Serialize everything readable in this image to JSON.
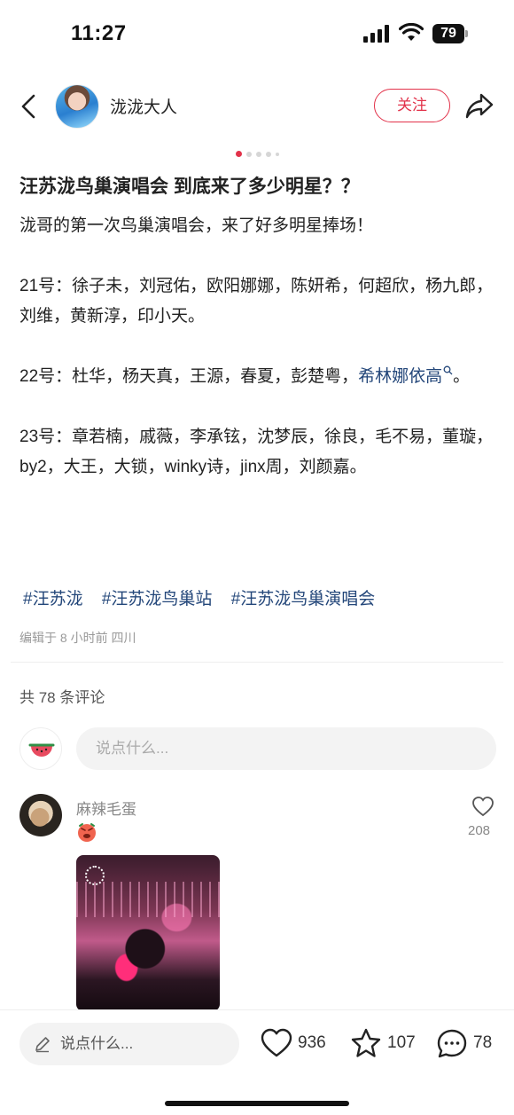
{
  "status_bar": {
    "time": "11:27",
    "battery": "79"
  },
  "header": {
    "author_name": "泷泷大人",
    "follow_label": "关注"
  },
  "carousel": {
    "total": 5,
    "active": 1
  },
  "post": {
    "title": "汪苏泷鸟巢演唱会 到底来了多少明星？？",
    "intro": "泷哥的第一次鸟巢演唱会，来了好多明星捧场！",
    "day21": "21号：徐子未，刘冠佑，欧阳娜娜，陈妍希，何超欣，杨九郎，刘维，黄新淳，印小天。",
    "day22_prefix": "22号：杜华，杨天真，王源，春夏，彭楚粤，",
    "day22_link": "希林娜依高",
    "day22_suffix": "。",
    "day23": "23号：章若楠，戚薇，李承铉，沈梦辰，徐良，毛不易，董璇，by2，大王，大锁，winky诗，jinx周，刘颜嘉。",
    "tags": [
      "#汪苏泷",
      "#汪苏泷鸟巢站",
      "#汪苏泷鸟巢演唱会"
    ],
    "meta": "编辑于 8 小时前 四川"
  },
  "comments_section": {
    "count_label": "共 78 条评论",
    "input_placeholder": "说点什么..."
  },
  "comment": {
    "author": "麻辣毛蛋",
    "like_count": "208"
  },
  "bottom_bar": {
    "input_placeholder": "说点什么...",
    "likes": "936",
    "stars": "107",
    "comments": "78"
  },
  "colors": {
    "accent": "#e2324a",
    "link": "#24477a"
  }
}
